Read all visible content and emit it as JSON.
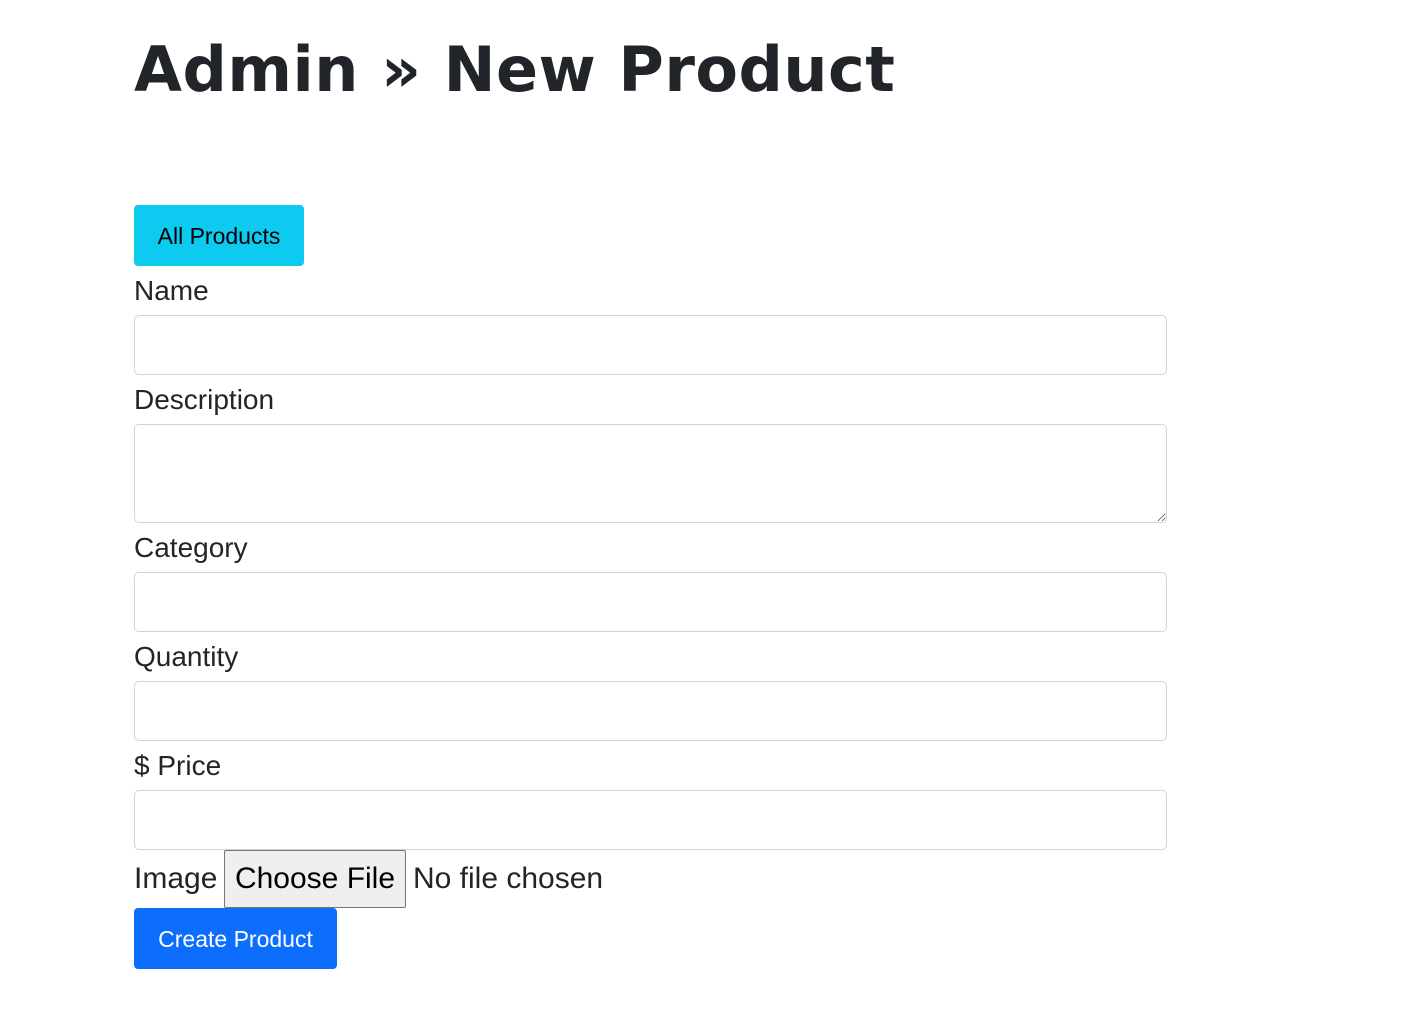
{
  "header": {
    "title": "Admin » New Product"
  },
  "nav": {
    "all_products_label": "All Products"
  },
  "form": {
    "name": {
      "label": "Name",
      "value": ""
    },
    "description": {
      "label": "Description",
      "value": ""
    },
    "category": {
      "label": "Category",
      "value": ""
    },
    "quantity": {
      "label": "Quantity",
      "value": ""
    },
    "price": {
      "label": "$ Price",
      "value": ""
    },
    "image": {
      "label": "Image",
      "button_label": "Choose File",
      "status": "No file chosen"
    },
    "submit_label": "Create Product"
  },
  "colors": {
    "info_button": "#0dcaf0",
    "primary_button": "#0d6efd",
    "text": "#212529",
    "input_border": "#ced4da"
  }
}
